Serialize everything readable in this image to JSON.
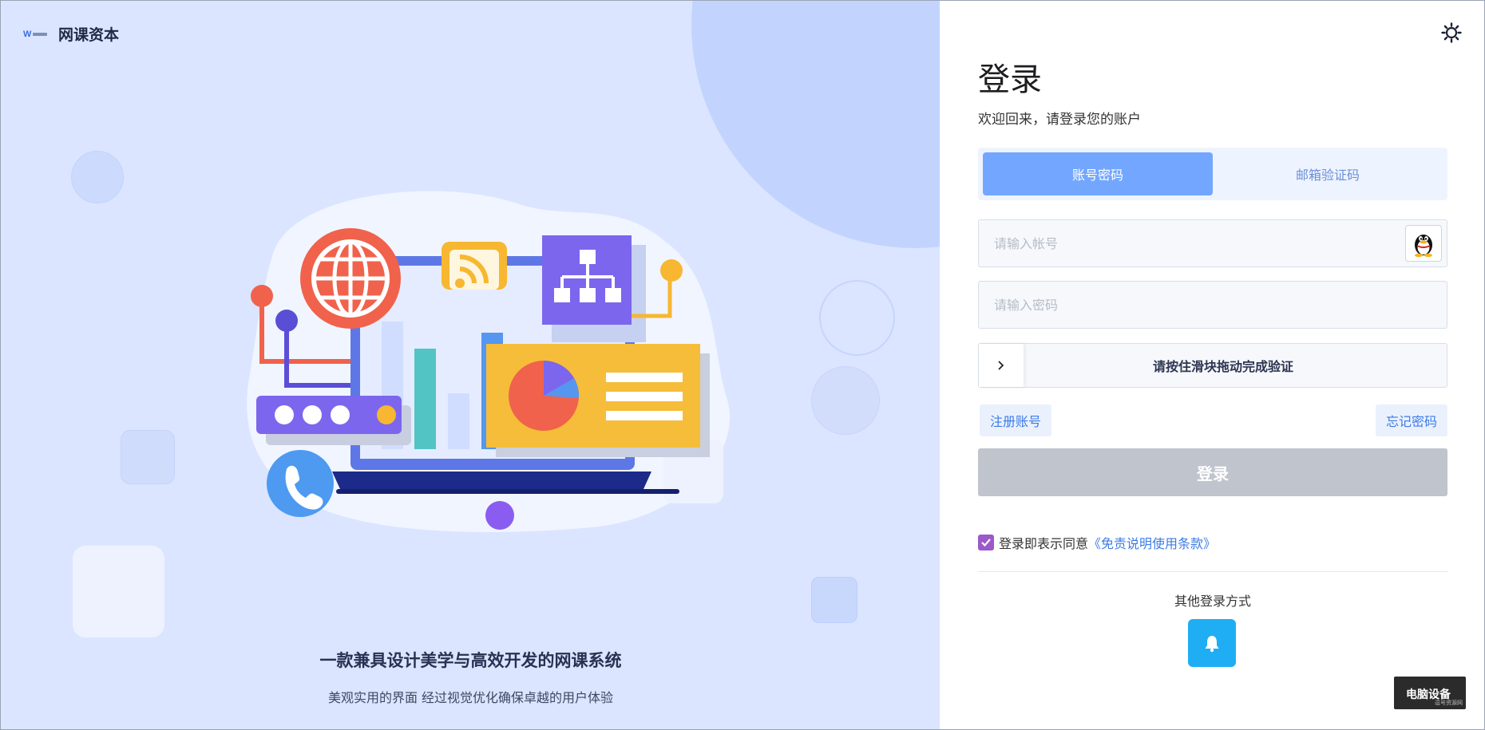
{
  "brand": {
    "name": "网课资本",
    "logo_letter": "W"
  },
  "hero": {
    "title": "一款兼具设计美学与高效开发的网课系统",
    "subtitle": "美观实用的界面 经过视觉优化确保卓越的用户体验"
  },
  "login": {
    "title": "登录",
    "subtitle": "欢迎回来，请登录您的账户",
    "tabs": [
      {
        "label": "账号密码",
        "active": true
      },
      {
        "label": "邮箱验证码",
        "active": false
      }
    ],
    "account_placeholder": "请输入帐号",
    "password_placeholder": "请输入密码",
    "slider_text": "请按住滑块拖动完成验证",
    "register_label": "注册账号",
    "forgot_label": "忘记密码",
    "submit_label": "登录",
    "agree_text": "登录即表示同意",
    "agree_link": "《免责说明使用条款》",
    "agree_checked": true,
    "other_methods_label": "其他登录方式"
  },
  "watermark": {
    "text": "电脑设备",
    "small": "逗号资源网"
  },
  "colors": {
    "left_bg": "#dbe5ff",
    "tab_active": "#73a7ff",
    "link": "#3d7be6",
    "checkbox": "#9b59c9",
    "submit_disabled": "#c0c4cc",
    "qq_login": "#1faef3"
  },
  "icons": {
    "settings": "sun-gear-icon",
    "qq": "qq-penguin-icon",
    "slider": "chevron-right-icon",
    "qq_login": "qq-bell-icon"
  }
}
